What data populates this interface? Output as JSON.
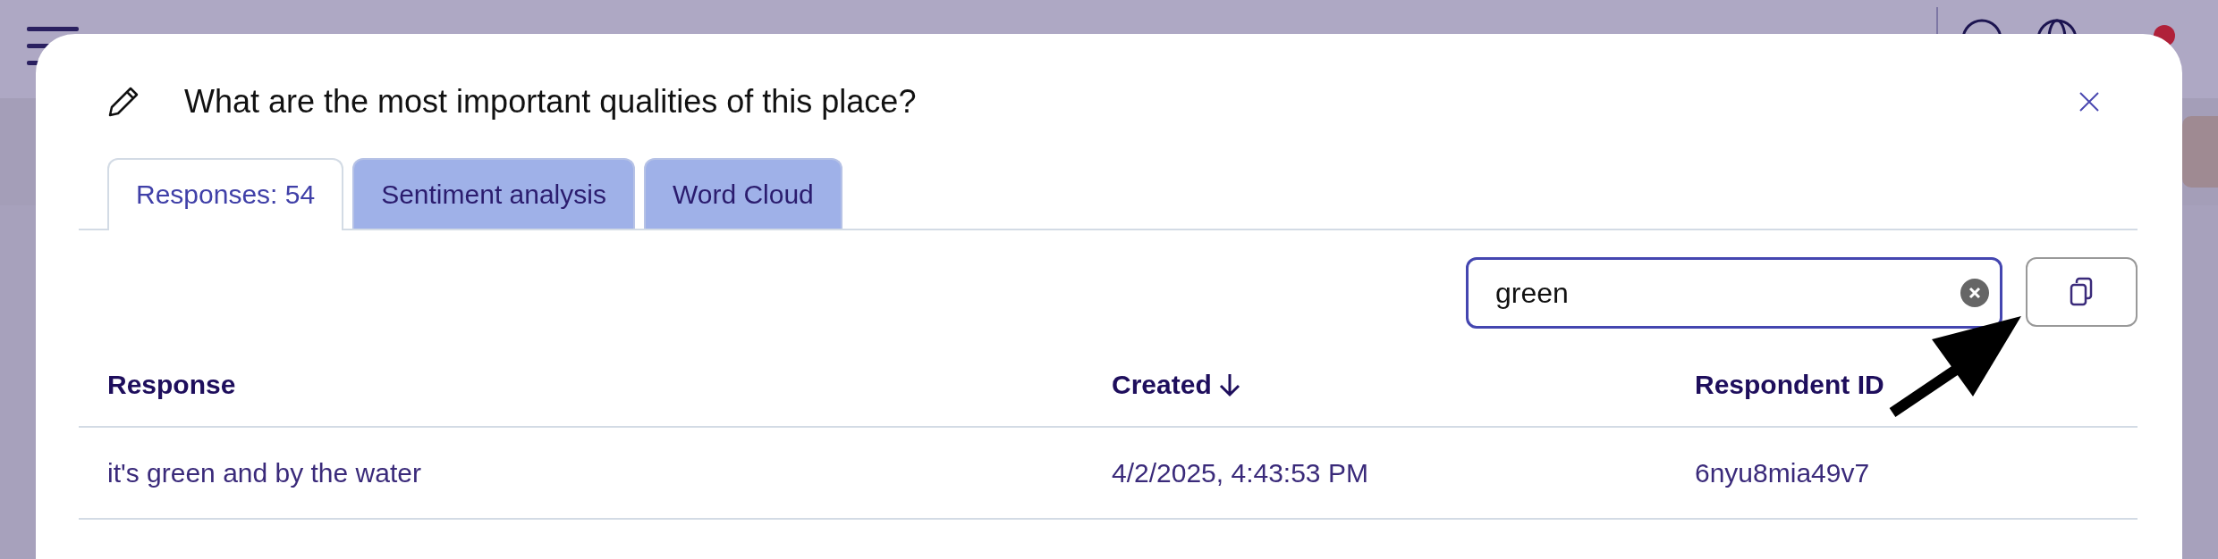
{
  "modal": {
    "title": "What are the most important qualities of this place?",
    "tabs": [
      {
        "label": "Responses: 54",
        "selected": true
      },
      {
        "label": "Sentiment analysis",
        "selected": false
      },
      {
        "label": "Word Cloud",
        "selected": false
      }
    ],
    "search": {
      "value": "green"
    },
    "table": {
      "columns": [
        {
          "label": "Response",
          "sorted": false
        },
        {
          "label": "Created",
          "sorted": true
        },
        {
          "label": "Respondent ID",
          "sorted": false
        }
      ],
      "rows": [
        [
          "it's green and by the water",
          "4/2/2025, 4:43:53 PM",
          "6nyu8mia49v7"
        ]
      ]
    }
  }
}
